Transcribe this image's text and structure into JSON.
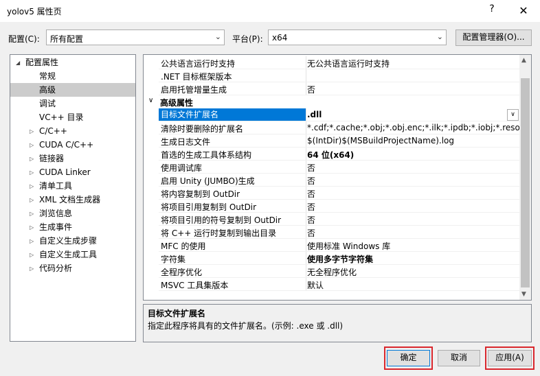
{
  "window": {
    "title": "yolov5 属性页",
    "help": "?",
    "close": "✕"
  },
  "toolbar": {
    "config_label": "配置(C):",
    "config_value": "所有配置",
    "platform_label": "平台(P):",
    "platform_value": "x64",
    "config_manager": "配置管理器(O)..."
  },
  "tree": {
    "root": "配置属性",
    "items": [
      {
        "label": "常规",
        "expandable": false,
        "selected": false
      },
      {
        "label": "高级",
        "expandable": false,
        "selected": true
      },
      {
        "label": "调试",
        "expandable": false,
        "selected": false
      },
      {
        "label": "VC++ 目录",
        "expandable": false,
        "selected": false
      },
      {
        "label": "C/C++",
        "expandable": true,
        "selected": false
      },
      {
        "label": "CUDA C/C++",
        "expandable": true,
        "selected": false
      },
      {
        "label": "链接器",
        "expandable": true,
        "selected": false
      },
      {
        "label": "CUDA Linker",
        "expandable": true,
        "selected": false
      },
      {
        "label": "清单工具",
        "expandable": true,
        "selected": false
      },
      {
        "label": "XML 文档生成器",
        "expandable": true,
        "selected": false
      },
      {
        "label": "浏览信息",
        "expandable": true,
        "selected": false
      },
      {
        "label": "生成事件",
        "expandable": true,
        "selected": false
      },
      {
        "label": "自定义生成步骤",
        "expandable": true,
        "selected": false
      },
      {
        "label": "自定义生成工具",
        "expandable": true,
        "selected": false
      },
      {
        "label": "代码分析",
        "expandable": true,
        "selected": false
      }
    ]
  },
  "grid": {
    "rows_top": [
      {
        "name": "公共语言运行时支持",
        "value": "无公共语言运行时支持",
        "bold": false
      },
      {
        "name": ".NET 目标框架版本",
        "value": "",
        "bold": false
      },
      {
        "name": "启用托管增量生成",
        "value": "否",
        "bold": false
      }
    ],
    "category": "高级属性",
    "rows": [
      {
        "name": "目标文件扩展名",
        "value": ".dll",
        "bold": true,
        "selected": true
      },
      {
        "name": "清除时要删除的扩展名",
        "value": "*.cdf;*.cache;*.obj;*.obj.enc;*.ilk;*.ipdb;*.iobj;*.resources;",
        "bold": false
      },
      {
        "name": "生成日志文件",
        "value": "$(IntDir)$(MSBuildProjectName).log",
        "bold": false
      },
      {
        "name": "首选的生成工具体系结构",
        "value": "64 位(x64)",
        "bold": true
      },
      {
        "name": "使用调试库",
        "value": "否",
        "bold": false
      },
      {
        "name": "启用 Unity (JUMBO)生成",
        "value": "否",
        "bold": false
      },
      {
        "name": "将内容复制到 OutDir",
        "value": "否",
        "bold": false
      },
      {
        "name": "将项目引用复制到 OutDir",
        "value": "否",
        "bold": false
      },
      {
        "name": "将项目引用的符号复制到 OutDir",
        "value": "否",
        "bold": false
      },
      {
        "name": "将 C++ 运行时复制到输出目录",
        "value": "否",
        "bold": false
      },
      {
        "name": "MFC 的使用",
        "value": "使用标准 Windows 库",
        "bold": false
      },
      {
        "name": "字符集",
        "value": "使用多字节字符集",
        "bold": true
      },
      {
        "name": "全程序优化",
        "value": "无全程序优化",
        "bold": false
      },
      {
        "name": "MSVC 工具集版本",
        "value": "默认",
        "bold": false
      }
    ]
  },
  "description": {
    "title": "目标文件扩展名",
    "text": "指定此程序将具有的文件扩展名。(示例: .exe 或 .dll)"
  },
  "buttons": {
    "ok": "确定",
    "cancel": "取消",
    "apply": "应用(A)"
  },
  "colors": {
    "selection": "#0078d7",
    "highlight_box": "#d9262c"
  }
}
